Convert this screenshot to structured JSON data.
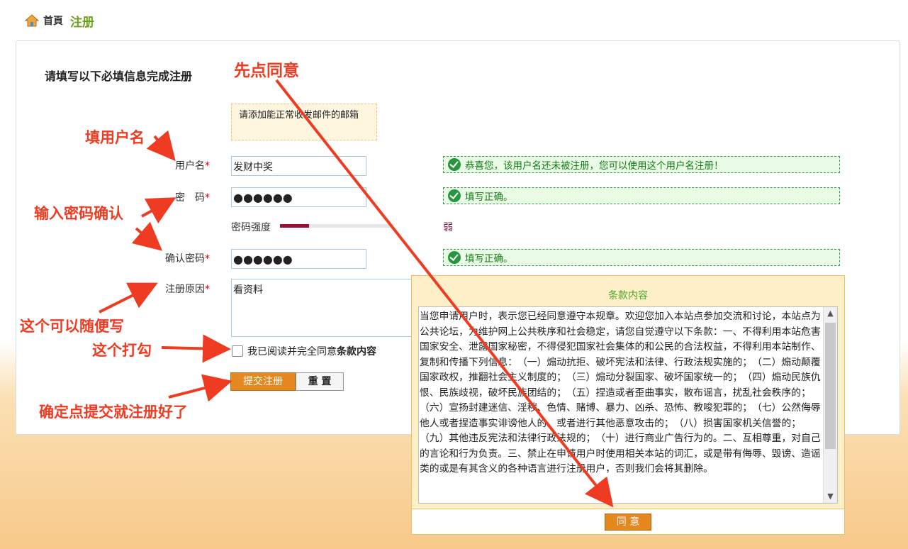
{
  "breadcrumb": {
    "home": "首頁",
    "current": "注册"
  },
  "form": {
    "title": "请填写以下必填信息完成注册",
    "email_hint": "请添加能正常收发邮件的邮箱",
    "username": {
      "label": "用户名",
      "required_mark": "*",
      "value": "发财中奖",
      "status": "恭喜您，该用户名还未被注册，您可以使用这个用户名注册！"
    },
    "password": {
      "label": "密　码",
      "required_mark": "*",
      "value": "●●●●●●",
      "status": "填写正确。"
    },
    "strength": {
      "label": "密码强度",
      "level_text": "弱",
      "level": 0.26
    },
    "confirm": {
      "label": "确认密码",
      "required_mark": "*",
      "value": "●●●●●●",
      "status": "填写正确。"
    },
    "reason": {
      "label": "注册原因",
      "required_mark": "*",
      "value": "看资料"
    },
    "agree": {
      "text": "我已阅读并完全同意",
      "link": "条款内容",
      "checked": false
    },
    "submit_label": "提交注册",
    "reset_label": "重 置"
  },
  "terms": {
    "title": "条款内容",
    "body": "当您申请用户时，表示您已经同意遵守本规章。欢迎您加入本站点参加交流和讨论，本站点为公共论坛，为维护网上公共秩序和社会稳定，请您自觉遵守以下条款：一、不得利用本站危害国家安全、泄露国家秘密，不得侵犯国家社会集体的和公民的合法权益，不得利用本站制作、复制和传播下列信息：　（一）煽动抗拒、破坏宪法和法律、行政法规实施的；　（二）煽动颠覆国家政权，推翻社会主义制度的；　（三）煽动分裂国家、破坏国家统一的；　（四）煽动民族仇恨、民族歧视，破坏民族团结的；　（五）捏造或者歪曲事实，散布谣言，扰乱社会秩序的；　（六）宣扬封建迷信、淫秽、色情、赌博、暴力、凶杀、恐怖、教唆犯罪的；　（七）公然侮辱他人或者捏造事实诽谤他人的，或者进行其他恶意攻击的；　（八）损害国家机关信誉的；　（九）其他违反宪法和法律行政法规的；　（十）进行商业广告行为的。二、互相尊重，对自己的言论和行为负责。三、禁止在申请用户时使用相关本站的词汇，或是带有侮辱、毁谤、造谣类的或是有其含义的各种语言进行注册用户，否则我们会将其删除。",
    "agree_label": "同 意"
  },
  "annotations": {
    "agree_first": "先点同意",
    "fill_username": "填用户名",
    "enter_password": "输入密码确认",
    "write_anything": "这个可以随便写",
    "check_this": "这个打勾",
    "submit_done": "确定点提交就注册好了"
  },
  "colors": {
    "accent": "#e5881f",
    "success": "#26963f",
    "annotation": "#ef3b22",
    "brand_green": "#6ba21a"
  }
}
